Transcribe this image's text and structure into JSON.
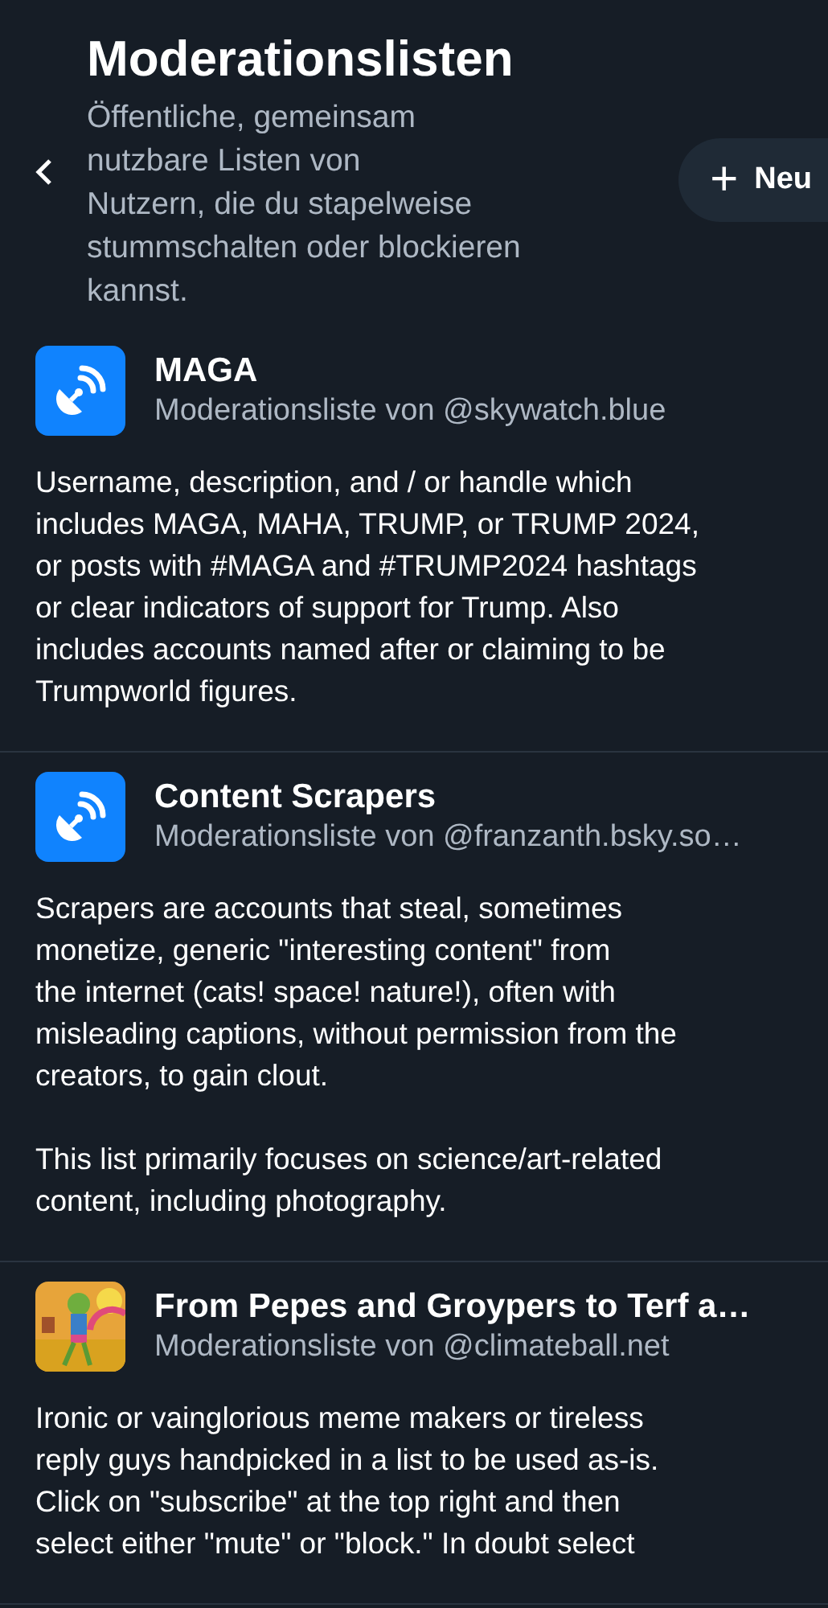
{
  "header": {
    "title": "Moderationslisten",
    "subtitle": "Öffentliche, gemeinsam\nnutzbare Listen von\nNutzern, die du stapelweise\nstummschalten oder blockieren\nkannst.",
    "new_button": {
      "icon": "+",
      "label": "Neu"
    }
  },
  "lists": [
    {
      "avatar": {
        "kind": "icon"
      },
      "name": "MAGA",
      "byline": "Moderationsliste von @skywatch.blue",
      "description": [
        "Username, description, and / or handle which\nincludes MAGA, MAHA, TRUMP, or TRUMP 2024,\nor posts with #MAGA and #TRUMP2024 hashtags\nor clear indicators of support for Trump. Also\nincludes accounts named after or claiming to be\nTrumpworld figures."
      ]
    },
    {
      "avatar": {
        "kind": "icon"
      },
      "name": "Content Scrapers",
      "byline": "Moderationsliste von @franzanth.bsky.so…",
      "description": [
        "Scrapers are accounts that steal, sometimes\nmonetize, generic \"interesting content\" from\nthe internet (cats! space! nature!), often with\nmisleading captions, without permission from the\ncreators, to gain clout.",
        "This list primarily focuses on science/art-related\ncontent, including photography."
      ]
    },
    {
      "avatar": {
        "kind": "picture"
      },
      "name": "From Pepes and Groypers to Terf a…",
      "byline": "Moderationsliste von @climateball.net",
      "description": [
        "Ironic or vainglorious meme makers or tireless\nreply guys handpicked in a list to be used as-is.\nClick on \"subscribe\" at the top right and then\nselect either \"mute\" or \"block.\" In doubt select"
      ]
    }
  ]
}
